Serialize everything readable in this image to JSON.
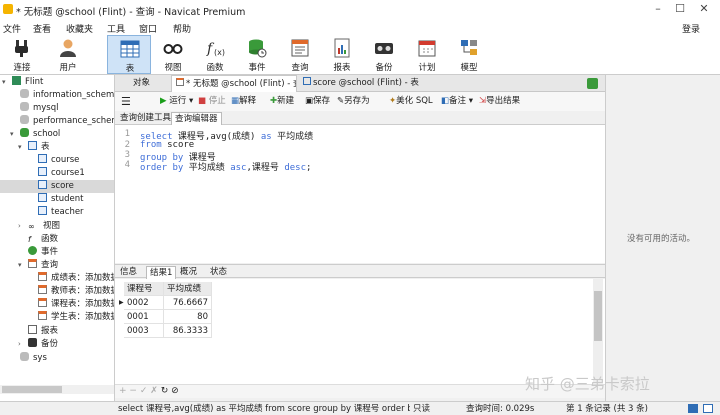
{
  "window": {
    "title": "* 无标题 @school (Flint) - 查询 - Navicat Premium",
    "login": "登录"
  },
  "menu": [
    "文件",
    "查看",
    "收藏夹",
    "工具",
    "窗口",
    "帮助"
  ],
  "toolbar": [
    {
      "label": "连接",
      "icon": "plug-icon"
    },
    {
      "label": "用户",
      "icon": "user-icon"
    },
    {
      "label": "表",
      "icon": "table-icon"
    },
    {
      "label": "视图",
      "icon": "glasses-icon"
    },
    {
      "label": "函数",
      "icon": "function-icon"
    },
    {
      "label": "事件",
      "icon": "event-icon"
    },
    {
      "label": "查询",
      "icon": "query-icon"
    },
    {
      "label": "报表",
      "icon": "report-icon"
    },
    {
      "label": "备份",
      "icon": "backup-icon"
    },
    {
      "label": "计划",
      "icon": "calendar-icon"
    },
    {
      "label": "模型",
      "icon": "model-icon"
    }
  ],
  "tree": {
    "connection": "Flint",
    "databases": [
      "information_schema",
      "mysql",
      "performance_schema"
    ],
    "school": "school",
    "tables_label": "表",
    "tables": [
      "course",
      "course1",
      "score",
      "student",
      "teacher"
    ],
    "views_label": "视图",
    "functions_label": "函数",
    "events_label": "事件",
    "queries_label": "查询",
    "queries": [
      "成绩表：添加数据",
      "教师表：添加数据",
      "课程表：添加数据",
      "学生表：添加数据"
    ],
    "reports_label": "报表",
    "backups_label": "备份",
    "sys": "sys"
  },
  "tabs": {
    "object": "对象",
    "query": "* 无标题 @school (Flint) - 查...",
    "score": "score @school (Flint) - 表"
  },
  "query_toolbar": {
    "run": "运行",
    "stop": "停止",
    "explain": "解释",
    "new": "新建",
    "save": "保存",
    "saveas": "另存为",
    "beautify": "美化 SQL",
    "note": "备注",
    "export": "导出结果"
  },
  "subtabs": [
    "查询创建工具",
    "查询编辑器"
  ],
  "sql_lines": [
    {
      "n": "1",
      "parts": [
        [
          "kw",
          "select"
        ],
        [
          "t",
          " 课程号,avg(成绩) "
        ],
        [
          "kw",
          "as"
        ],
        [
          "t",
          " 平均成绩"
        ]
      ]
    },
    {
      "n": "2",
      "parts": [
        [
          "kw",
          "from"
        ],
        [
          "t",
          " score"
        ]
      ]
    },
    {
      "n": "3",
      "parts": [
        [
          "kw",
          "group by"
        ],
        [
          "t",
          " 课程号"
        ]
      ]
    },
    {
      "n": "4",
      "parts": [
        [
          "kw",
          "order by"
        ],
        [
          "t",
          " 平均成绩 "
        ],
        [
          "kw",
          "asc"
        ],
        [
          "t",
          ",课程号 "
        ],
        [
          "kw",
          "desc"
        ],
        [
          "t",
          ";"
        ]
      ]
    }
  ],
  "result_tabs": [
    "信息",
    "结果1",
    "概况",
    "状态"
  ],
  "result": {
    "columns": [
      "课程号",
      "平均成绩"
    ],
    "rows": [
      [
        "0002",
        "76.6667"
      ],
      [
        "0001",
        "80"
      ],
      [
        "0003",
        "86.3333"
      ]
    ]
  },
  "right_pane": "没有可用的活动。",
  "status": {
    "sql": "select 课程号,avg(成绩) as 平均成绩 from score group by 课程号 order by 平",
    "mode": "只读",
    "time": "查询时间: 0.029s",
    "records": "第 1 条记录 (共 3 条)"
  },
  "watermark": "知乎 @三弟卡索拉",
  "colors": {
    "keyword": "#3f6ed8",
    "accent": "#cfe3f7",
    "run_green": "#1a9e1a",
    "stop_red": "#d04040"
  }
}
